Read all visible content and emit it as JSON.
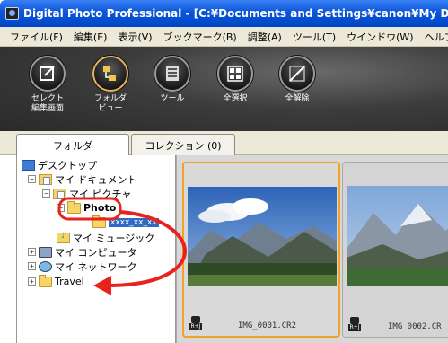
{
  "window": {
    "title": "Digital Photo Professional - [C:¥Documents and Settings¥canon¥My D"
  },
  "menu": [
    "ファイル(F)",
    "編集(E)",
    "表示(V)",
    "ブックマーク(B)",
    "調整(A)",
    "ツール(T)",
    "ウインドウ(W)",
    "ヘルプ(H)"
  ],
  "toolbar": {
    "items": [
      {
        "label": "セレクト\n編集画面",
        "icon": "select-edit-icon"
      },
      {
        "label": "フォルダ\nビュー",
        "icon": "folder-view-icon"
      },
      {
        "label": "ツール",
        "icon": "tool-icon"
      },
      {
        "label": "全選択",
        "icon": "select-all-icon"
      },
      {
        "label": "全解除",
        "icon": "deselect-all-icon"
      }
    ]
  },
  "tabs": {
    "folder": "フォルダ",
    "collection": "コレクション (0)"
  },
  "tree": {
    "desktop": "デスクトップ",
    "my_documents": "マイ ドキュメント",
    "my_pictures": "マイ ピクチャ",
    "photo": "Photo",
    "subfolder": "xxxx_xx_xx",
    "my_music": "マイ ミュージック",
    "my_computer": "マイ コンピュータ",
    "my_network": "マイ ネットワーク",
    "travel": "Travel"
  },
  "thumbnails": [
    {
      "filename": "IMG_0001.CR2",
      "badge": "R+J"
    },
    {
      "filename": "IMG_0002.CR",
      "badge": "R+J"
    }
  ],
  "colors": {
    "annotation": "#e8231d",
    "selection": "#316ac5",
    "thumb_selected_border": "#f0a326",
    "title_bar": "#0b55d8"
  }
}
